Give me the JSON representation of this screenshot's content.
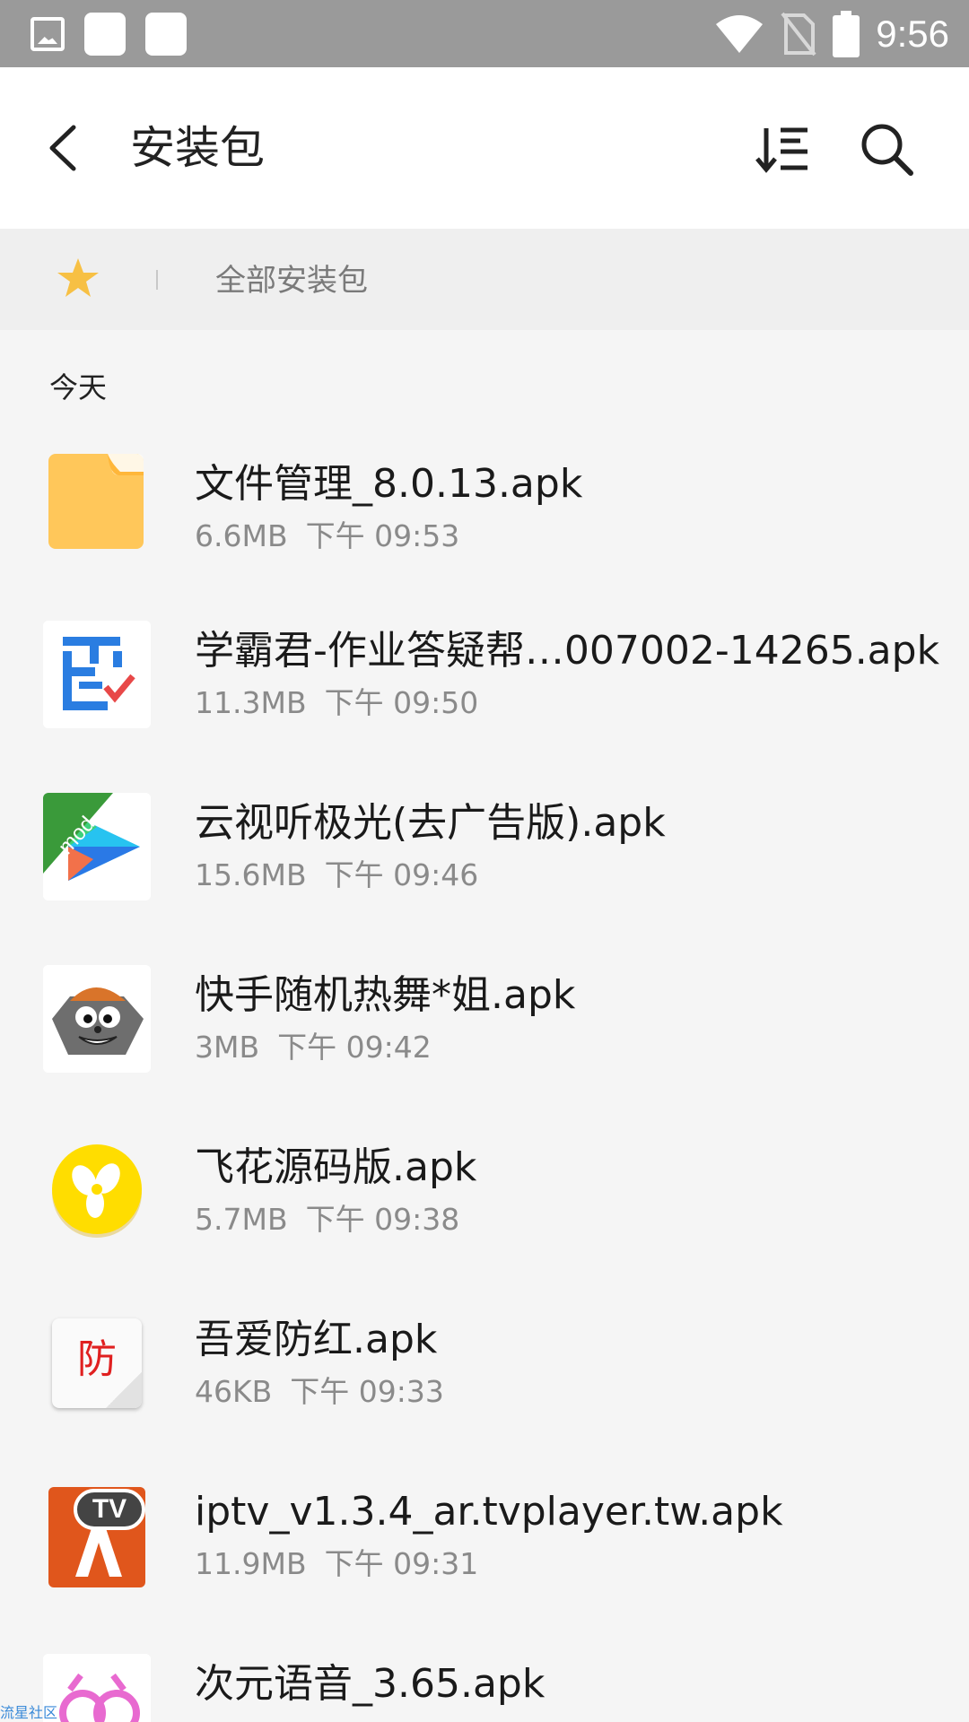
{
  "status_bar": {
    "time": "9:56",
    "icons": [
      "image-notification-icon",
      "notification-box-icon",
      "notification-box-icon",
      "wifi-icon",
      "no-sim-icon",
      "battery-icon"
    ]
  },
  "app_bar": {
    "title": "安装包",
    "back_icon": "back-arrow-icon",
    "sort_icon": "sort-icon",
    "search_icon": "search-icon"
  },
  "filter_bar": {
    "favorite_icon": "star-icon",
    "label": "全部安装包",
    "accent": "#f7c044"
  },
  "list": {
    "section": "今天",
    "items": [
      {
        "name": "文件管理_8.0.13.apk",
        "size": "6.6MB",
        "time": "下午 09:53",
        "icon": "folder-icon"
      },
      {
        "name": "学霸君-作业答疑帮…007002-14265.apk",
        "size": "11.3MB",
        "time": "下午 09:50",
        "icon": "xuebajun-app-icon"
      },
      {
        "name": "云视听极光(去广告版).apk",
        "size": "15.6MB",
        "time": "下午 09:46",
        "icon": "video-play-app-icon"
      },
      {
        "name": "快手随机热舞*姐.apk",
        "size": "3MB",
        "time": "下午 09:42",
        "icon": "cartoon-wolf-app-icon"
      },
      {
        "name": "飞花源码版.apk",
        "size": "5.7MB",
        "time": "下午 09:38",
        "icon": "yellow-flower-app-icon"
      },
      {
        "name": "吾爱防红.apk",
        "size": "46KB",
        "time": "下午 09:33",
        "icon": "fang-character-app-icon",
        "icon_text": "防"
      },
      {
        "name": "iptv_v1.3.4_ar.tvplayer.tw.apk",
        "size": "11.9MB",
        "time": "下午 09:31",
        "icon": "tv-app-icon",
        "icon_text": "TV"
      },
      {
        "name": "次元语音_3.65.apk",
        "size": "",
        "time": "",
        "icon": "pink-character-app-icon"
      }
    ]
  },
  "watermark": "流星社区"
}
